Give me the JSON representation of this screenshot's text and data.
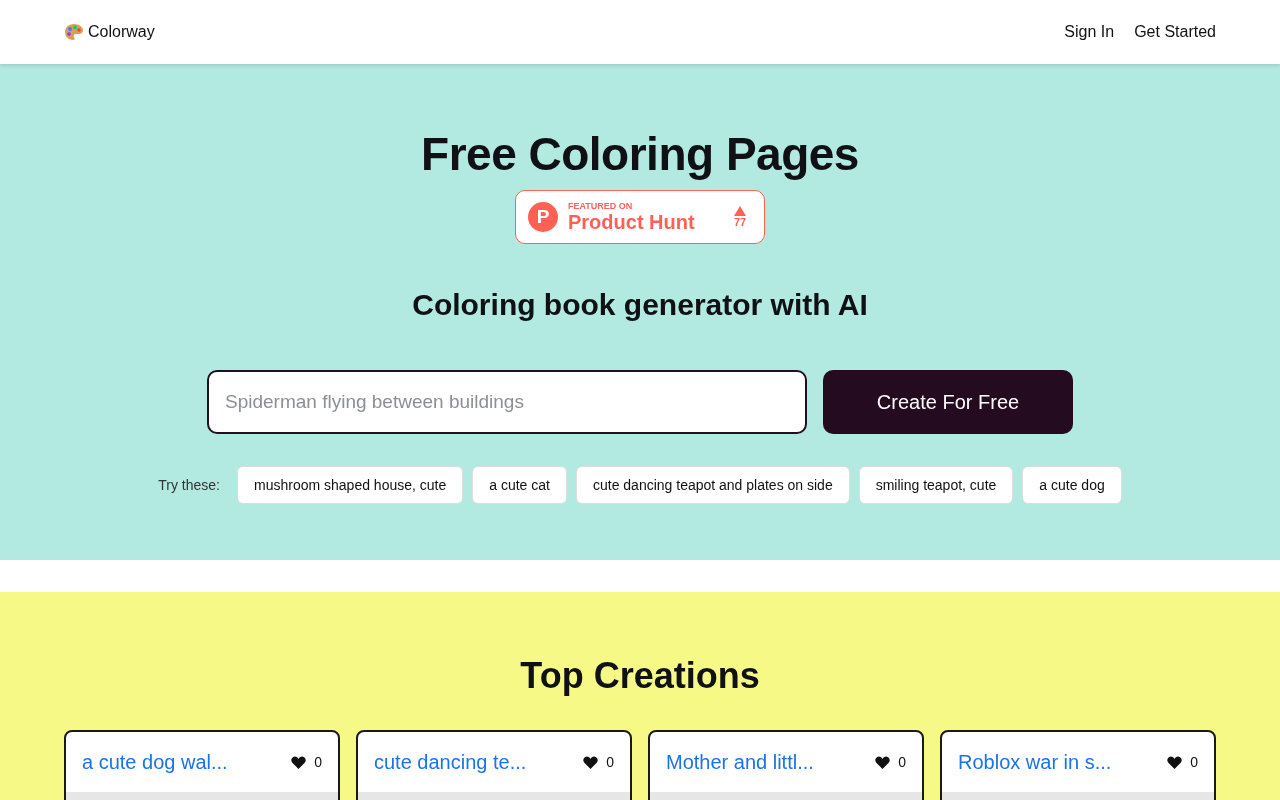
{
  "header": {
    "brand": "Colorway",
    "nav": [
      "Sign In",
      "Get Started"
    ]
  },
  "hero": {
    "title": "Free Coloring Pages",
    "badge": {
      "logo_letter": "P",
      "eyebrow": "FEATURED ON",
      "name": "Product Hunt",
      "votes": "77"
    },
    "subtitle": "Coloring book generator with AI",
    "search": {
      "placeholder": "Spiderman flying between buildings"
    },
    "button": "Create For Free",
    "suggest_label": "Try these:",
    "suggestions": [
      "mushroom shaped house, cute",
      "a cute cat",
      "cute dancing teapot and plates on side",
      "smiling teapot, cute",
      "a cute dog"
    ]
  },
  "creations": {
    "title": "Top Creations",
    "cards": [
      {
        "title": "a cute dog wal...",
        "likes": "0"
      },
      {
        "title": "cute dancing te...",
        "likes": "0"
      },
      {
        "title": "Mother and littl...",
        "likes": "0"
      },
      {
        "title": "Roblox war in s...",
        "likes": "0"
      }
    ]
  }
}
